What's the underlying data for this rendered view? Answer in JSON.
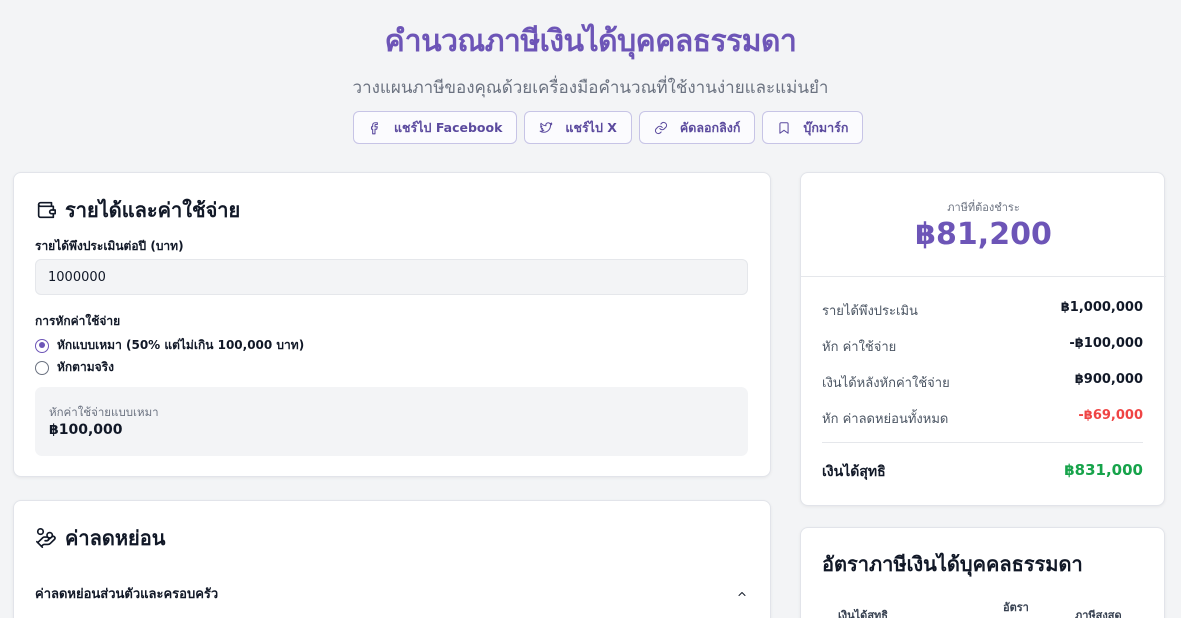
{
  "header": {
    "title": "คำนวณภาษีเงินได้บุคคลธรรมดา",
    "subtitle": "วางแผนภาษีของคุณด้วยเครื่องมือคำนวณที่ใช้งานง่ายและแม่นยำ"
  },
  "share": [
    {
      "label": "แชร์ไป Facebook",
      "icon": "facebook-icon"
    },
    {
      "label": "แชร์ไป X",
      "icon": "twitter-icon"
    },
    {
      "label": "คัดลอกลิงก์",
      "icon": "link-icon"
    },
    {
      "label": "บุ๊กมาร์ก",
      "icon": "bookmark-icon"
    }
  ],
  "income": {
    "title": "รายได้และค่าใช้จ่าย",
    "income_label": "รายได้พึงประเมินต่อปี (บาท)",
    "income_value": "1000000",
    "expense_label": "การหักค่าใช้จ่าย",
    "option_flat": "หักแบบเหมา (50% แต่ไม่เกิน 100,000 บาท)",
    "option_actual": "หักตามจริง",
    "selected_option": "flat",
    "flat_box_label": "หักค่าใช้จ่ายแบบเหมา",
    "flat_box_value": "฿100,000"
  },
  "deductions": {
    "title": "ค่าลดหย่อน",
    "section_personal": "ค่าลดหย่อนส่วนตัวและครอบครัว"
  },
  "tax": {
    "label": "ภาษีที่ต้องชำระ",
    "amount": "฿81,200",
    "rows": [
      {
        "key": "รายได้พึงประเมิน",
        "value": "฿1,000,000"
      },
      {
        "key": "หัก ค่าใช้จ่าย",
        "value": "-฿100,000"
      },
      {
        "key": "เงินได้หลังหักค่าใช้จ่าย",
        "value": "฿900,000"
      },
      {
        "key": "หัก ค่าลดหย่อนทั้งหมด",
        "value": "-฿69,000"
      }
    ],
    "net_label": "เงินได้สุทธิ",
    "net_value": "฿831,000"
  },
  "rates": {
    "title": "อัตราภาษีเงินได้บุคคลธรรมดา",
    "col_net": "เงินได้สุทธิ",
    "col_rate": "อัตรา",
    "col_max": "ภาษีสูงสุด"
  },
  "colors": {
    "accent": "#6d55b7",
    "negative": "#ef4444",
    "positive": "#16a34a"
  }
}
